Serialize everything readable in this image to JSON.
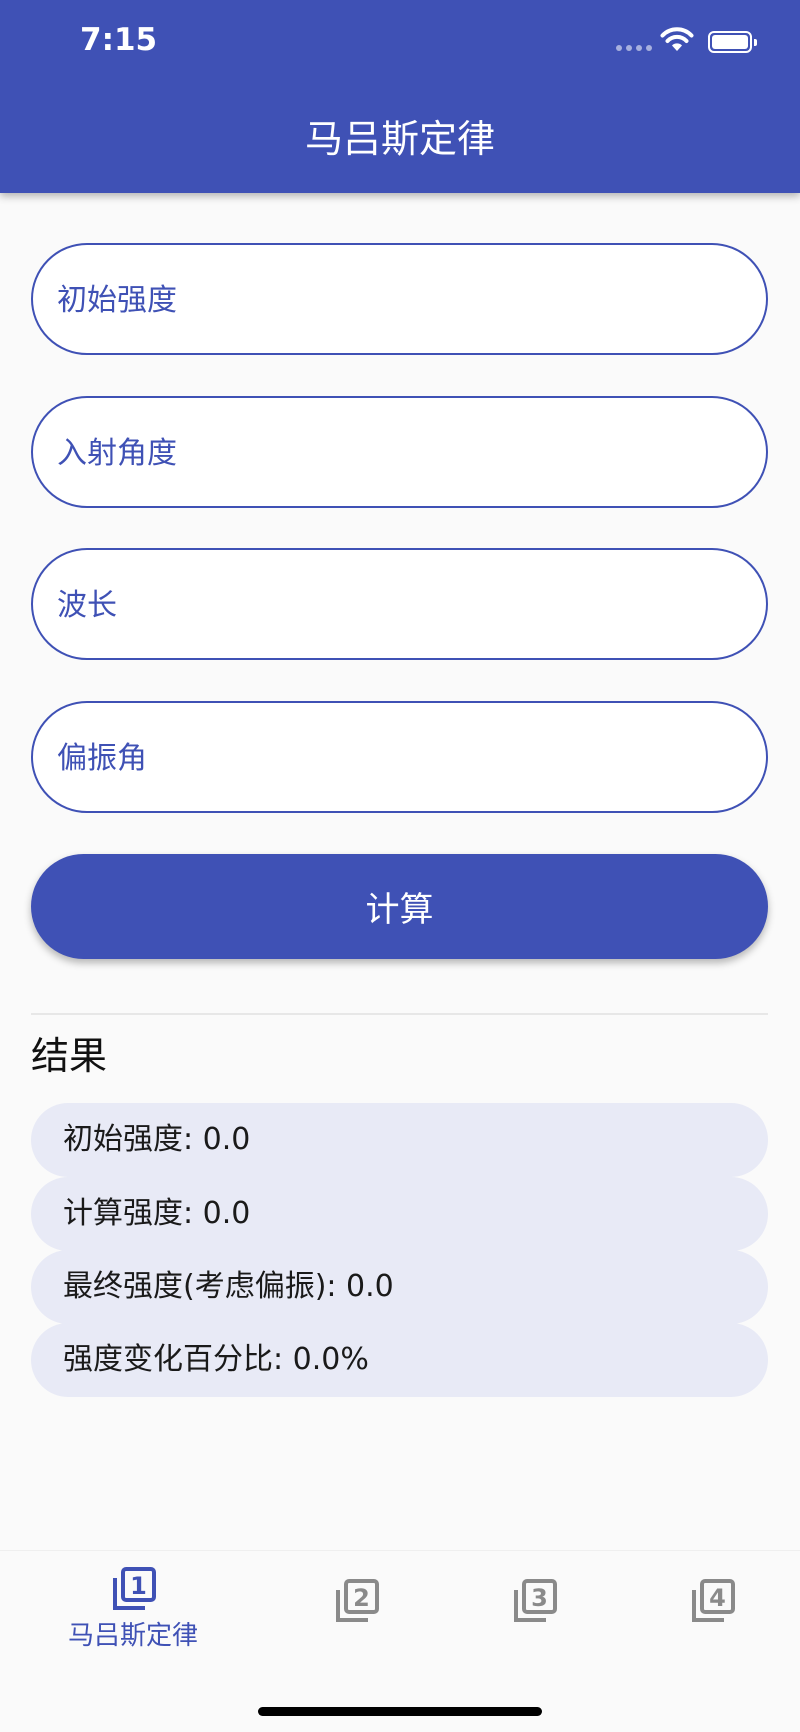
{
  "status_bar": {
    "time": "7:15"
  },
  "app_bar": {
    "title": "马吕斯定律"
  },
  "form": {
    "initial_intensity_placeholder": "初始强度",
    "incident_angle_placeholder": "入射角度",
    "wavelength_placeholder": "波长",
    "polarization_angle_placeholder": "偏振角",
    "calculate_label": "计算"
  },
  "results": {
    "title": "结果",
    "rows": [
      "初始强度: 0.0",
      "计算强度: 0.0",
      "最终强度(考虑偏振): 0.0",
      "强度变化百分比: 0.0%"
    ]
  },
  "bottom_nav": {
    "items": [
      {
        "label": "马吕斯定律",
        "icon": "filter-1-icon",
        "active": true
      },
      {
        "label": "",
        "icon": "filter-2-icon",
        "active": false
      },
      {
        "label": "",
        "icon": "filter-3-icon",
        "active": false
      },
      {
        "label": "",
        "icon": "filter-4-icon",
        "active": false
      }
    ]
  },
  "colors": {
    "primary": "#3f51b5",
    "inactive_icon": "#8a8a8a",
    "result_row_bg": "#e8eaf6",
    "background": "#fafafa"
  }
}
